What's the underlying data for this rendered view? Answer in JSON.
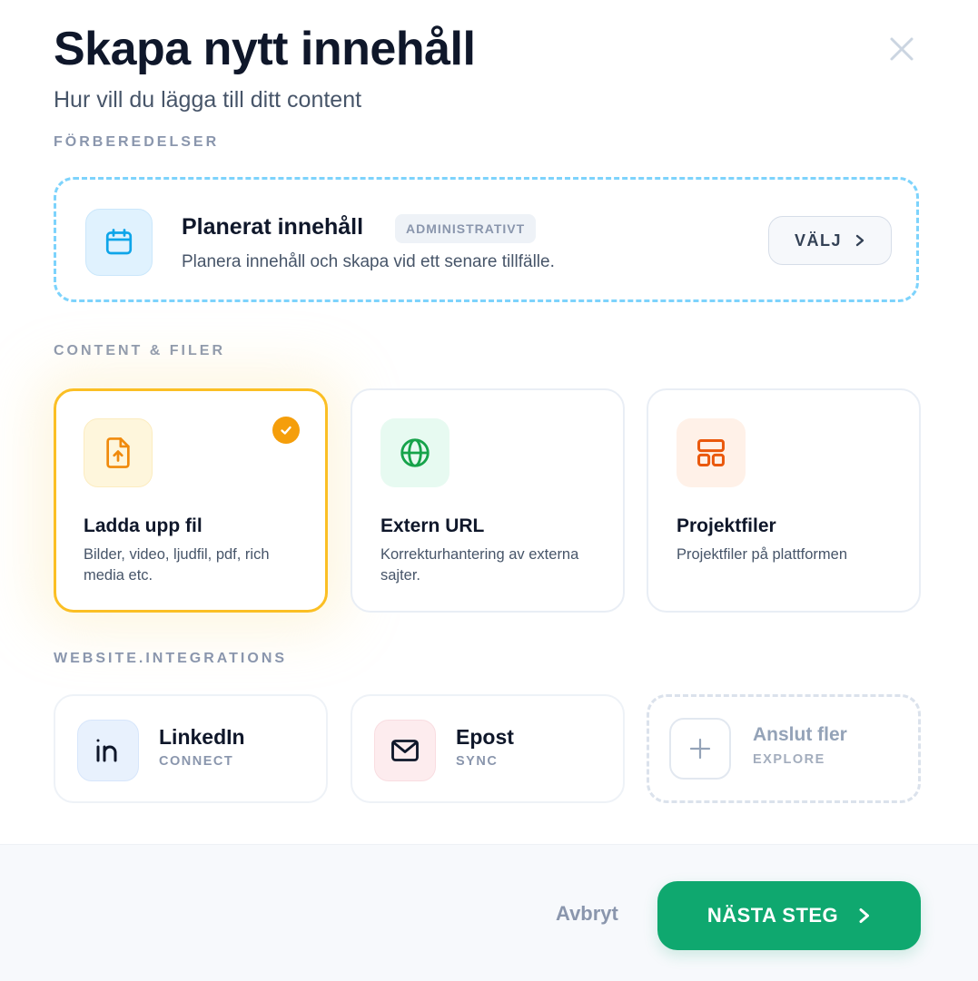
{
  "header": {
    "title": "Skapa nytt innehåll",
    "subtitle": "Hur vill du lägga till ditt content"
  },
  "sections": {
    "preparations": "FÖRBEREDELSER",
    "content_files": "CONTENT & FILER",
    "integrations": "WEBSITE.INTEGRATIONS"
  },
  "planned": {
    "title": "Planerat innehåll",
    "badge": "ADMINISTRATIVT",
    "description": "Planera innehåll och skapa vid ett senare tillfälle.",
    "button_label": "VÄLJ",
    "icon": "calendar-icon"
  },
  "content_cards": [
    {
      "title": "Ladda upp fil",
      "description": "Bilder, video, ljudfil, pdf, rich media etc.",
      "selected": true,
      "icon": "file-upload-icon",
      "accent": "#f59e0b"
    },
    {
      "title": "Extern URL",
      "description": "Korrekturhantering av externa sajter.",
      "selected": false,
      "icon": "globe-icon",
      "accent": "#16a34a"
    },
    {
      "title": "Projektfiler",
      "description": "Projektfiler på plattformen",
      "selected": false,
      "icon": "layout-grid-icon",
      "accent": "#ea580c"
    }
  ],
  "integrations": [
    {
      "name": "LinkedIn",
      "sub": "CONNECT",
      "icon": "linkedin-icon"
    },
    {
      "name": "Epost",
      "sub": "SYNC",
      "icon": "mail-icon"
    },
    {
      "name": "Anslut fler",
      "sub": "EXPLORE",
      "icon": "plus-icon"
    }
  ],
  "footer": {
    "cancel_label": "Avbryt",
    "next_label": "NÄSTA STEG"
  },
  "colors": {
    "primary": "#0fa86f",
    "selected_border": "#fbbf24",
    "planned_dash": "#7dd3fc"
  }
}
